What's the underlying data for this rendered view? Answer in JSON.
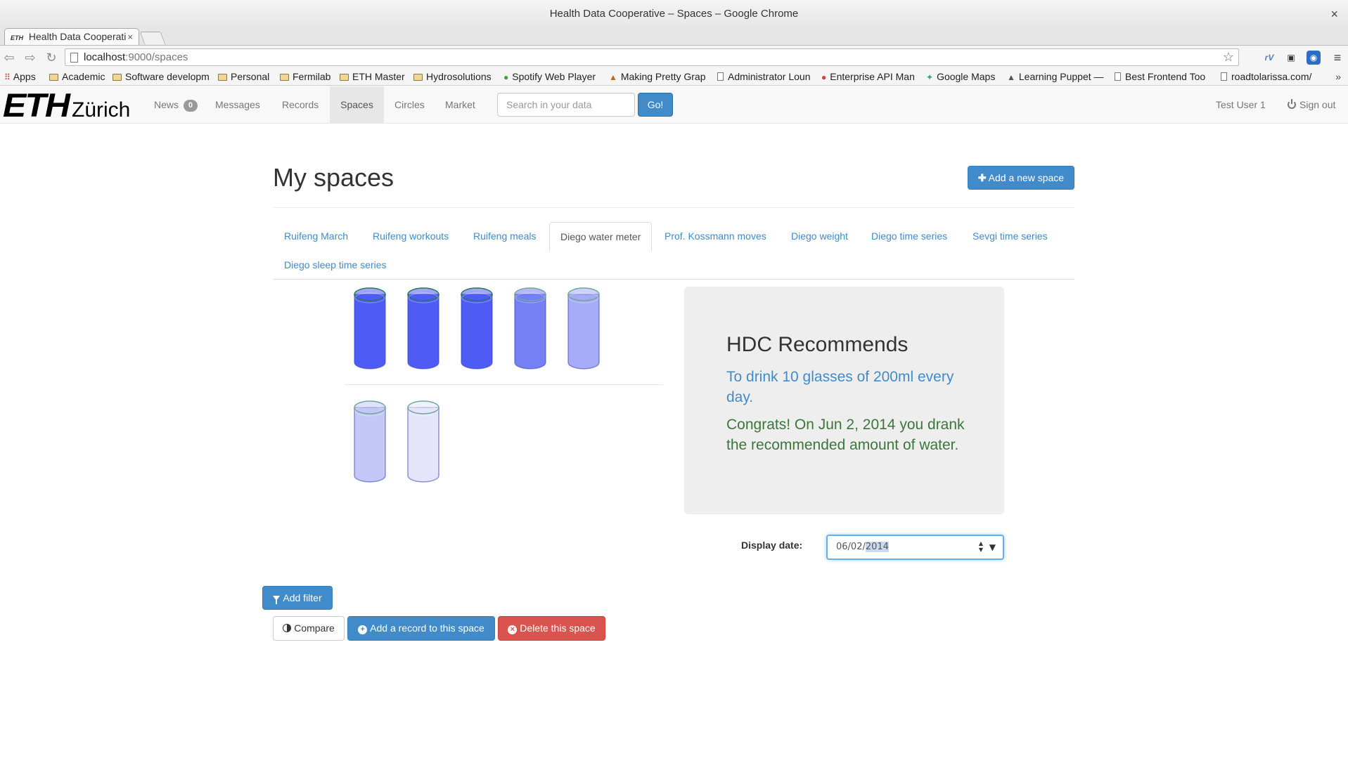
{
  "window": {
    "title": "Health Data Cooperative – Spaces – Google Chrome",
    "close": "×"
  },
  "tab": {
    "favicon": "ETH",
    "title": "Health Data Cooperati",
    "close": "×"
  },
  "address": {
    "host": "localhost",
    "path": ":9000/spaces"
  },
  "icons": {
    "back": "⇦",
    "forward": "⇨",
    "reload": "↻",
    "star": "☆",
    "menu": "≡",
    "ext1": "rV",
    "ext2": "▣",
    "ext3": "◉"
  },
  "bookmarks": {
    "apps": "Apps",
    "items": [
      {
        "label": "Academic",
        "icon": "folder"
      },
      {
        "label": "Software developm",
        "icon": "folder"
      },
      {
        "label": "Personal",
        "icon": "folder"
      },
      {
        "label": "Fermilab",
        "icon": "folder"
      },
      {
        "label": "ETH Master",
        "icon": "folder"
      },
      {
        "label": "Hydrosolutions",
        "icon": "folder"
      },
      {
        "label": "Spotify Web Player",
        "icon": "spotify"
      },
      {
        "label": "Making Pretty Grap",
        "icon": "matlab"
      },
      {
        "label": "Administrator Loun",
        "icon": "doc"
      },
      {
        "label": "Enterprise API Man",
        "icon": "api"
      },
      {
        "label": "Google Maps",
        "icon": "maps"
      },
      {
        "label": "Learning Puppet —",
        "icon": "puppet"
      },
      {
        "label": "Best Frontend Too",
        "icon": "doc"
      },
      {
        "label": "roadtolarissa.com/",
        "icon": "doc"
      }
    ],
    "more": "»"
  },
  "logo": {
    "mark": "ETH",
    "city": "Zürich"
  },
  "nav": {
    "news": "News",
    "news_count": "0",
    "messages": "Messages",
    "records": "Records",
    "spaces": "Spaces",
    "circles": "Circles",
    "market": "Market",
    "search_placeholder": "Search in your data",
    "go": "Go!",
    "user": "Test User 1",
    "signout": "Sign out"
  },
  "page": {
    "title": "My spaces",
    "add_space": "Add a new space"
  },
  "spaces_tabs": [
    "Ruifeng March",
    "Ruifeng workouts",
    "Ruifeng meals",
    "Diego water meter",
    "Prof. Kossmann moves",
    "Diego weight",
    "Diego time series",
    "Sevgi time series",
    "Diego sleep time series"
  ],
  "active_tab": "Diego water meter",
  "glasses": {
    "colors": [
      "#4f5bf5",
      "#4f5bf5",
      "#4f5bf5",
      "#7580f5",
      "#a6acf7",
      "#c4c7f8",
      "#e4e5fb"
    ]
  },
  "recommendation": {
    "title": "HDC Recommends",
    "text": "To drink 10 glasses of 200ml every day.",
    "success": "Congrats! On Jun 2, 2014 you drank the recommended amount of water."
  },
  "date": {
    "label": "Display date:",
    "prefix": "06/02/",
    "selected": "2014"
  },
  "actions": {
    "add_filter": "Add filter",
    "compare": "Compare",
    "add_record": "Add a record to this space",
    "delete_space": "Delete this space"
  }
}
